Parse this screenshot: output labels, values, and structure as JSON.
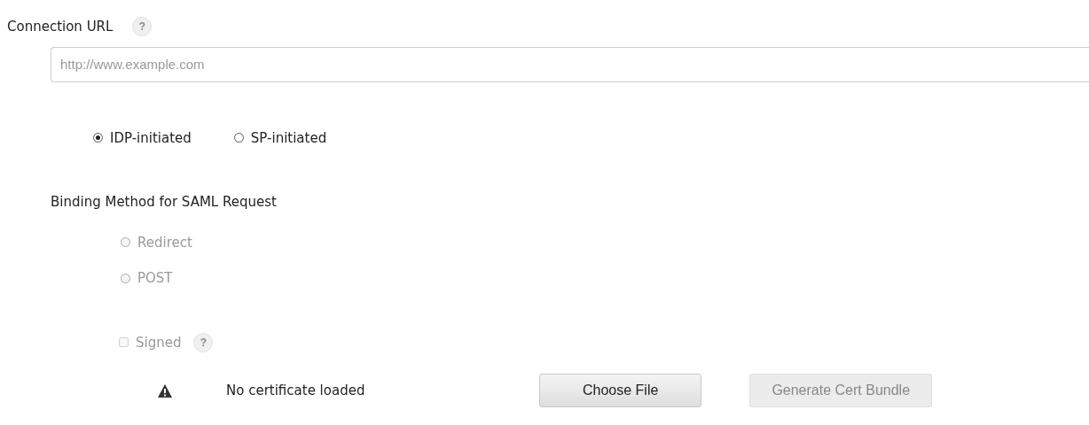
{
  "connection_url": {
    "label": "Connection URL",
    "help": "?",
    "placeholder": "http://www.example.com"
  },
  "initiation": [
    {
      "label": "IDP-initiated",
      "selected": true
    },
    {
      "label": "SP-initiated",
      "selected": false
    }
  ],
  "binding": {
    "label": "Binding Method for SAML Request",
    "options": [
      {
        "label": "Redirect",
        "selected": false,
        "disabled": true
      },
      {
        "label": "POST",
        "selected": false,
        "disabled": true
      }
    ]
  },
  "signed": {
    "label": "Signed",
    "checked": false,
    "disabled": true,
    "help": "?"
  },
  "certificate": {
    "status": "No certificate loaded",
    "buttons": [
      {
        "label": "Choose File",
        "disabled": false
      },
      {
        "label": "Generate Cert Bundle",
        "disabled": true
      }
    ]
  }
}
